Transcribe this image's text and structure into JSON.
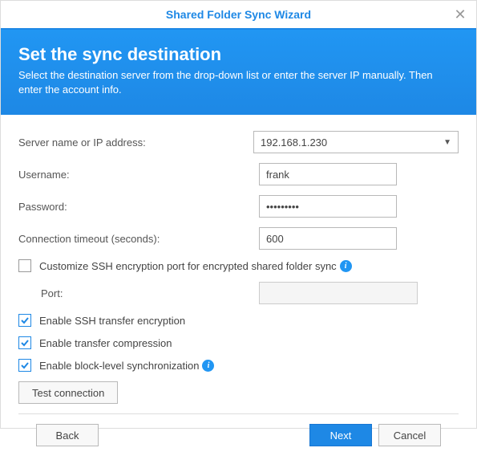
{
  "window": {
    "title": "Shared Folder Sync Wizard"
  },
  "header": {
    "title": "Set the sync destination",
    "subtitle": "Select the destination server from the drop-down list or enter the server IP manually. Then enter the account info."
  },
  "form": {
    "server_label": "Server name or IP address:",
    "server_value": "192.168.1.230",
    "username_label": "Username:",
    "username_value": "frank",
    "password_label": "Password:",
    "password_value": "•••••••••",
    "timeout_label": "Connection timeout (seconds):",
    "timeout_value": "600",
    "customize_ssh_label": "Customize SSH encryption port for encrypted shared folder sync",
    "port_label": "Port:",
    "port_value": "",
    "enable_ssh_label": "Enable SSH transfer encryption",
    "enable_compression_label": "Enable transfer compression",
    "enable_block_label": "Enable block-level synchronization",
    "test_connection_label": "Test connection"
  },
  "footer": {
    "back": "Back",
    "next": "Next",
    "cancel": "Cancel"
  }
}
